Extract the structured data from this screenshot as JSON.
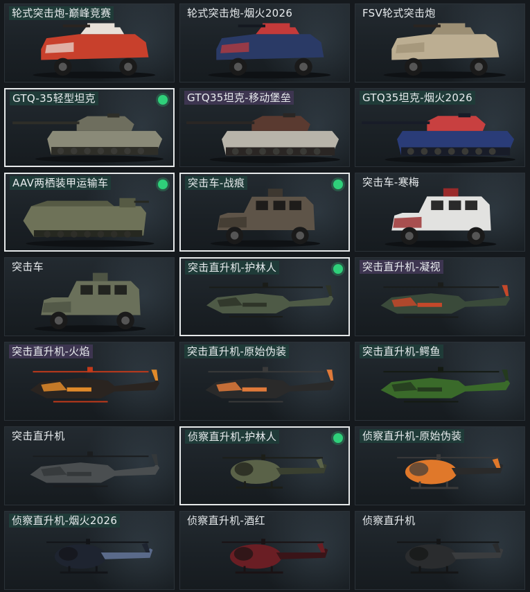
{
  "vehicles": [
    {
      "name": "轮式突击炮-巅峰竞赛",
      "kind": "wheeled",
      "label_style": "teal",
      "equipped": false,
      "selected": false,
      "colors": [
        "#c8402c",
        "#e8e0d8",
        "#2a2420"
      ]
    },
    {
      "name": "轮式突击炮-烟火2026",
      "kind": "wheeled",
      "label_style": "none",
      "equipped": false,
      "selected": false,
      "colors": [
        "#2a3a66",
        "#c43a3a",
        "#141820"
      ]
    },
    {
      "name": "FSV轮式突击炮",
      "kind": "wheeled",
      "label_style": "none",
      "equipped": false,
      "selected": false,
      "colors": [
        "#bcae92",
        "#9c8f74",
        "#2a2420"
      ]
    },
    {
      "name": "GTQ-35轻型坦克",
      "kind": "tank",
      "label_style": "teal",
      "equipped": true,
      "selected": true,
      "colors": [
        "#8a8a78",
        "#6e6e5e",
        "#2e2e28"
      ]
    },
    {
      "name": "GTQ35坦克-移动堡垒",
      "kind": "tank",
      "label_style": "purple",
      "equipped": false,
      "selected": false,
      "colors": [
        "#b8b4aa",
        "#5a3a30",
        "#2a2624"
      ]
    },
    {
      "name": "GTQ35坦克-烟火2026",
      "kind": "tank",
      "label_style": "teal",
      "equipped": false,
      "selected": false,
      "colors": [
        "#2a3c78",
        "#c84040",
        "#181c28"
      ]
    },
    {
      "name": "AAV两栖装甲运输车",
      "kind": "amphib",
      "label_style": "teal",
      "equipped": true,
      "selected": true,
      "colors": [
        "#6e7258",
        "#565a44",
        "#262820"
      ]
    },
    {
      "name": "突击车-战痕",
      "kind": "mrap",
      "label_style": "teal",
      "equipped": true,
      "selected": true,
      "colors": [
        "#5e5448",
        "#3e3830",
        "#1e1c1a"
      ]
    },
    {
      "name": "突击车-寒梅",
      "kind": "mrap",
      "label_style": "none",
      "equipped": false,
      "selected": false,
      "colors": [
        "#e2e2e0",
        "#9a2a2a",
        "#2a2a2a"
      ]
    },
    {
      "name": "突击车",
      "kind": "mrap",
      "label_style": "none",
      "equipped": false,
      "selected": false,
      "colors": [
        "#6a705a",
        "#4e5444",
        "#222420"
      ]
    },
    {
      "name": "突击直升机-护林人",
      "kind": "heli",
      "label_style": "teal",
      "equipped": true,
      "selected": true,
      "colors": [
        "#4e5a46",
        "#2e3428",
        "#1a1c18"
      ]
    },
    {
      "name": "突击直升机-凝视",
      "kind": "heli",
      "label_style": "purple",
      "equipped": false,
      "selected": false,
      "colors": [
        "#3a4a3a",
        "#c4482a",
        "#1a1c1a"
      ]
    },
    {
      "name": "突击直升机-火焰",
      "kind": "heli",
      "label_style": "purple",
      "equipped": false,
      "selected": false,
      "colors": [
        "#2a2420",
        "#e08a2a",
        "#c43a1a"
      ]
    },
    {
      "name": "突击直升机-原始伪装",
      "kind": "heli",
      "label_style": "teal",
      "equipped": false,
      "selected": false,
      "colors": [
        "#2a2a2a",
        "#e07a3a",
        "#3a3a3a"
      ]
    },
    {
      "name": "突击直升机-鳄鱼",
      "kind": "heli",
      "label_style": "teal",
      "equipped": false,
      "selected": false,
      "colors": [
        "#3a6a2a",
        "#243a1e",
        "#141a12"
      ]
    },
    {
      "name": "突击直升机",
      "kind": "heli",
      "label_style": "none",
      "equipped": false,
      "selected": false,
      "colors": [
        "#4a4e50",
        "#34383a",
        "#1a1c1e"
      ]
    },
    {
      "name": "侦察直升机-护林人",
      "kind": "scout",
      "label_style": "teal",
      "equipped": true,
      "selected": true,
      "colors": [
        "#5a6248",
        "#3a4030",
        "#1c1e18"
      ]
    },
    {
      "name": "侦察直升机-原始伪装",
      "kind": "scout",
      "label_style": "teal",
      "equipped": false,
      "selected": false,
      "colors": [
        "#e0782a",
        "#2a2a2a",
        "#3a3a3a"
      ]
    },
    {
      "name": "侦察直升机-烟火2026",
      "kind": "scout",
      "label_style": "teal",
      "equipped": false,
      "selected": false,
      "colors": [
        "#1e2430",
        "#5a6a8a",
        "#121418"
      ]
    },
    {
      "name": "侦察直升机-酒红",
      "kind": "scout",
      "label_style": "none",
      "equipped": false,
      "selected": false,
      "colors": [
        "#6a1e24",
        "#3a1418",
        "#1a1214"
      ]
    },
    {
      "name": "侦察直升机",
      "kind": "scout",
      "label_style": "none",
      "equipped": false,
      "selected": false,
      "colors": [
        "#2a2c2e",
        "#3a3c3e",
        "#141516"
      ]
    }
  ]
}
